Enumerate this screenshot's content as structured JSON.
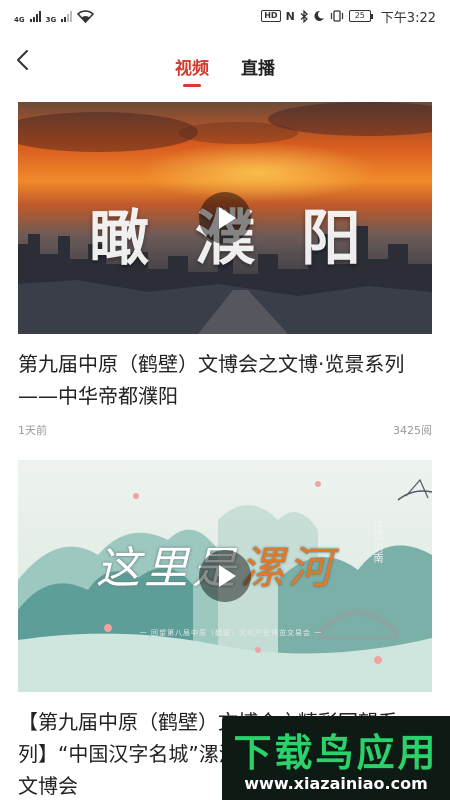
{
  "status_bar": {
    "network_1": "4G",
    "network_2": "3G",
    "hd": "HD",
    "nfc": "N",
    "battery": "25",
    "time": "下午3:22"
  },
  "header": {
    "back_icon": "chevron-left-icon",
    "tabs": [
      {
        "label": "视频",
        "active": true
      },
      {
        "label": "直播",
        "active": false
      }
    ],
    "accent_color": "#d23b2d"
  },
  "videos": [
    {
      "overlay_text": "瞰濮阳",
      "title": "第九届中原（鹤壁）文博会之文博·览景系列——中华帝都濮阳",
      "time_ago": "1天前",
      "views": "3425阅"
    },
    {
      "overlay_text_a": "这里是",
      "overlay_text_b": "漯河",
      "overlay_sub": "一 回望第八届中原（鹤壁）文化产业博览交易会 一",
      "overlay_vert": "中国·河南",
      "title": "【第九届中原（鹤壁）文博会之精彩回望系列】“中国汉字名城”漯河亮相历届中原（鹤壁）文博会"
    }
  ],
  "watermark": {
    "title": "下载鸟应用",
    "url": "www.xiazainiao.com"
  }
}
